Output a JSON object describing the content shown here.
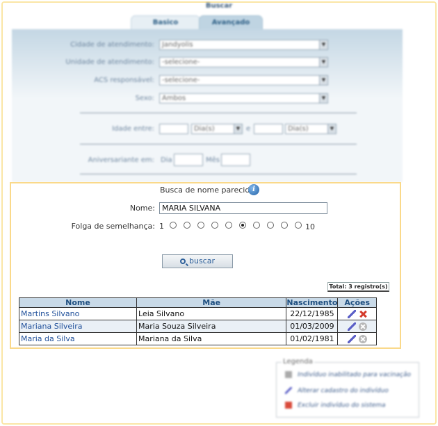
{
  "header": {
    "title": "Buscar"
  },
  "tabs": [
    {
      "label": "Basico"
    },
    {
      "label": "Avançado"
    }
  ],
  "form": {
    "cidade": {
      "label": "Cidade de atendimento:",
      "value": "Jandyolis"
    },
    "unidade": {
      "label": "Unidade de atendimento:",
      "value": "-selecione-"
    },
    "acs": {
      "label": "ACS responsável:",
      "value": "-selecione-"
    },
    "sexo": {
      "label": "Sexo:",
      "value": "Ambos"
    },
    "idade": {
      "label": "Idade entre:",
      "unit1": "Dia(s)",
      "separator": "e",
      "unit2": "Dia(s)"
    },
    "aniversariante": {
      "label": "Aniversariante em:",
      "dia": "Dia",
      "mes": "Mês"
    }
  },
  "similar": {
    "title": "Busca de nome parecido",
    "name_label": "Nome:",
    "name_value": "MARIA SILVANA",
    "folga_label": "Folga de semelhança:",
    "folga_min": "1",
    "folga_max": "10",
    "folga_selected": 6,
    "folga_options": 10,
    "search_label": "buscar"
  },
  "results": {
    "total": "Total: 3 registro(s)",
    "columns": [
      "Nome",
      "Mãe",
      "Nascimento",
      "Ações"
    ],
    "rows": [
      {
        "nome": "Martins Silvano",
        "mae": "Leia Silvano",
        "nascimento": "22/12/1985",
        "delete": "active"
      },
      {
        "nome": "Mariana Silveira",
        "mae": "Maria Souza Silveira",
        "nascimento": "01/03/2009",
        "delete": "disabled"
      },
      {
        "nome": "Maria da Silva",
        "mae": "Mariana da Silva",
        "nascimento": "01/02/1981",
        "delete": "disabled"
      }
    ]
  },
  "legend": {
    "title": "Legenda",
    "items": [
      {
        "icon": "gray-square-icon",
        "label": "Indivíduo inabilitado para vacinação"
      },
      {
        "icon": "pencil-icon",
        "label": "Alterar cadastro do indivíduo"
      },
      {
        "icon": "red-x-icon",
        "label": "Excluir indivíduo do sistema"
      }
    ]
  },
  "colors": {
    "accent": "#fad98a",
    "table_header": "#c9dae8",
    "link": "#1f4f9a"
  }
}
